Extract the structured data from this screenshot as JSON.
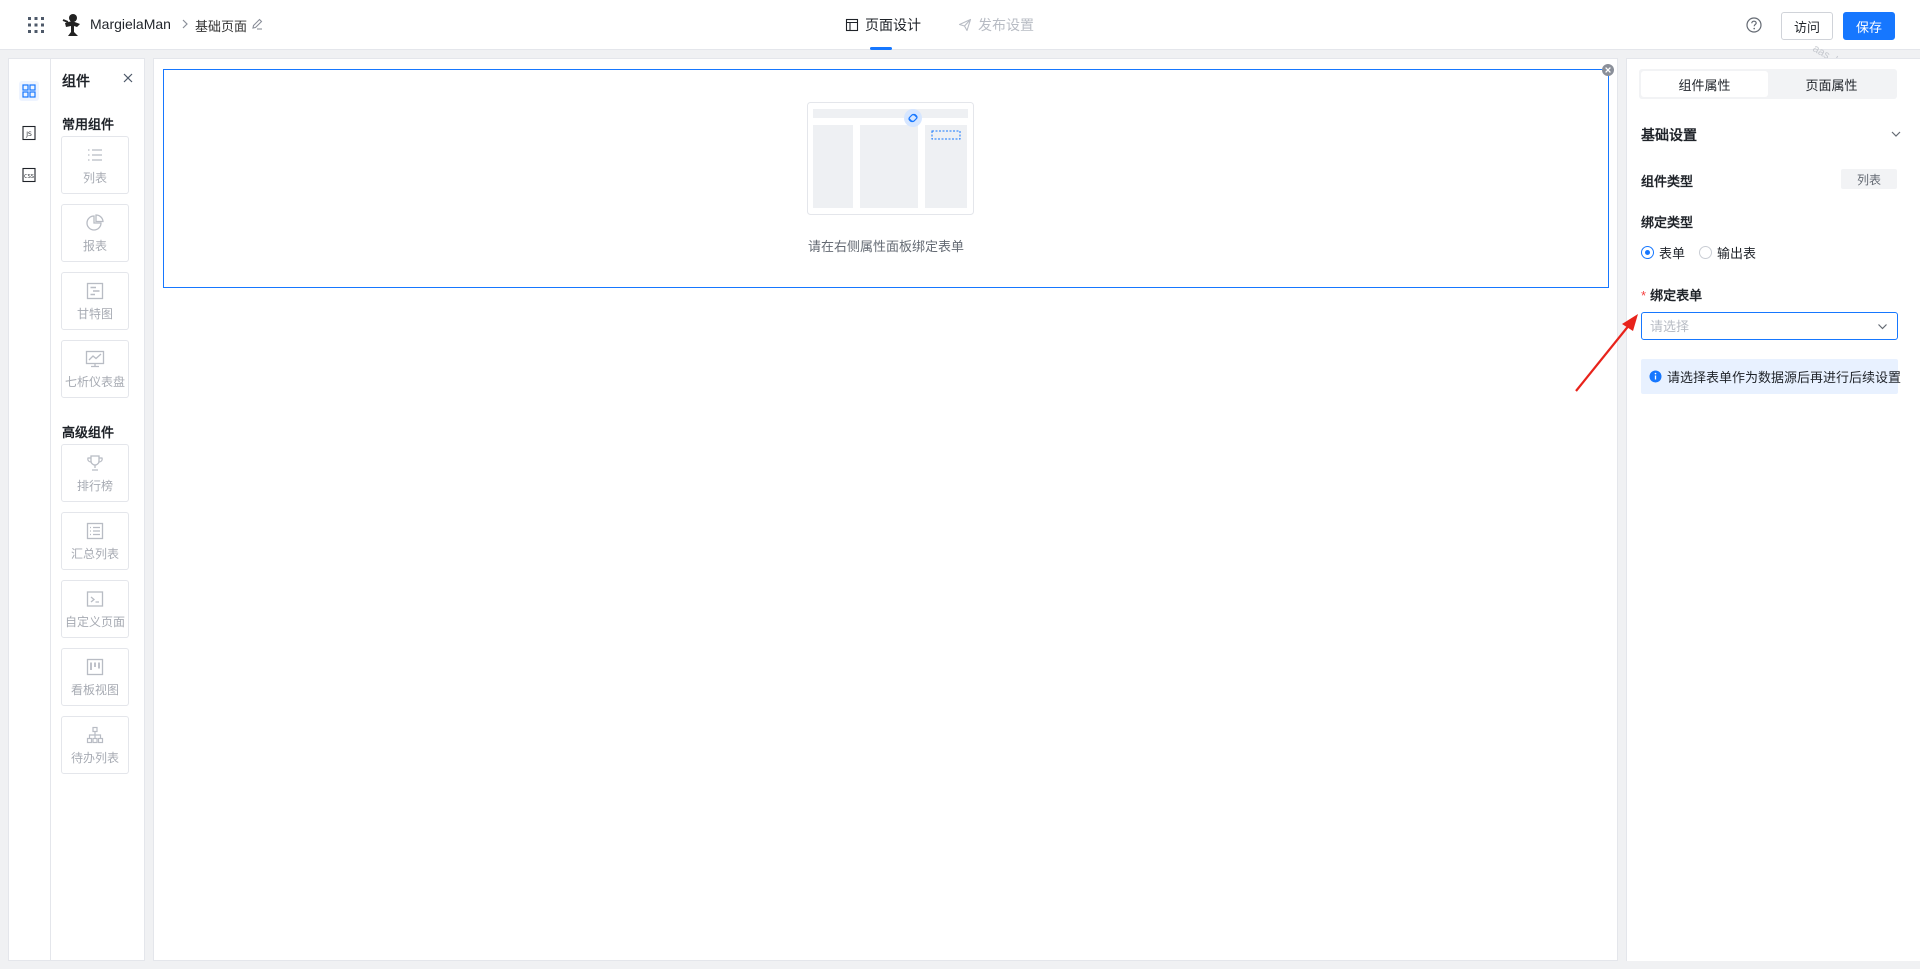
{
  "header": {
    "app_name": "MargielaMan",
    "page_name": "基础页面",
    "tabs": [
      {
        "label": "页面设计",
        "active": true,
        "icon": "layout-icon"
      },
      {
        "label": "发布设置",
        "active": false,
        "icon": "send-icon"
      }
    ],
    "visit_label": "访问",
    "save_label": "保存",
    "watermark": "aas_beta-提示环境"
  },
  "rail": {
    "items": [
      {
        "icon": "components-grid-icon",
        "active": true
      },
      {
        "icon": "js-file-icon",
        "active": false
      },
      {
        "icon": "css-file-icon",
        "active": false
      }
    ]
  },
  "components_panel": {
    "title": "组件",
    "common_section": "常用组件",
    "common_items": [
      {
        "label": "列表",
        "icon": "list-icon"
      },
      {
        "label": "报表",
        "icon": "pie-chart-icon"
      },
      {
        "label": "甘特图",
        "icon": "gantt-icon"
      },
      {
        "label": "七析仪表盘",
        "icon": "dashboard-icon"
      }
    ],
    "advanced_section": "高级组件",
    "advanced_items": [
      {
        "label": "排行榜",
        "icon": "trophy-icon"
      },
      {
        "label": "汇总列表",
        "icon": "summary-list-icon"
      },
      {
        "label": "自定义页面",
        "icon": "terminal-icon"
      },
      {
        "label": "看板视图",
        "icon": "kanban-icon"
      },
      {
        "label": "待办列表",
        "icon": "org-tree-icon"
      }
    ]
  },
  "canvas": {
    "empty_hint": "请在右侧属性面板绑定表单"
  },
  "properties_panel": {
    "tabs": [
      {
        "label": "组件属性",
        "active": true
      },
      {
        "label": "页面属性",
        "active": false
      }
    ],
    "section_title": "基础设置",
    "component_type_label": "组件类型",
    "component_type_value": "列表",
    "bind_type_label": "绑定类型",
    "bind_type_options": [
      {
        "label": "表单",
        "checked": true
      },
      {
        "label": "输出表",
        "checked": false
      }
    ],
    "required_mark": "*",
    "bind_form_label": "绑定表单",
    "bind_form_placeholder": "请选择",
    "bind_form_value": "",
    "info_text": "请选择表单作为数据源后再进行后续设置"
  },
  "colors": {
    "primary": "#1677ff",
    "required": "#f53f3f",
    "annotation_arrow": "#e8231b"
  }
}
